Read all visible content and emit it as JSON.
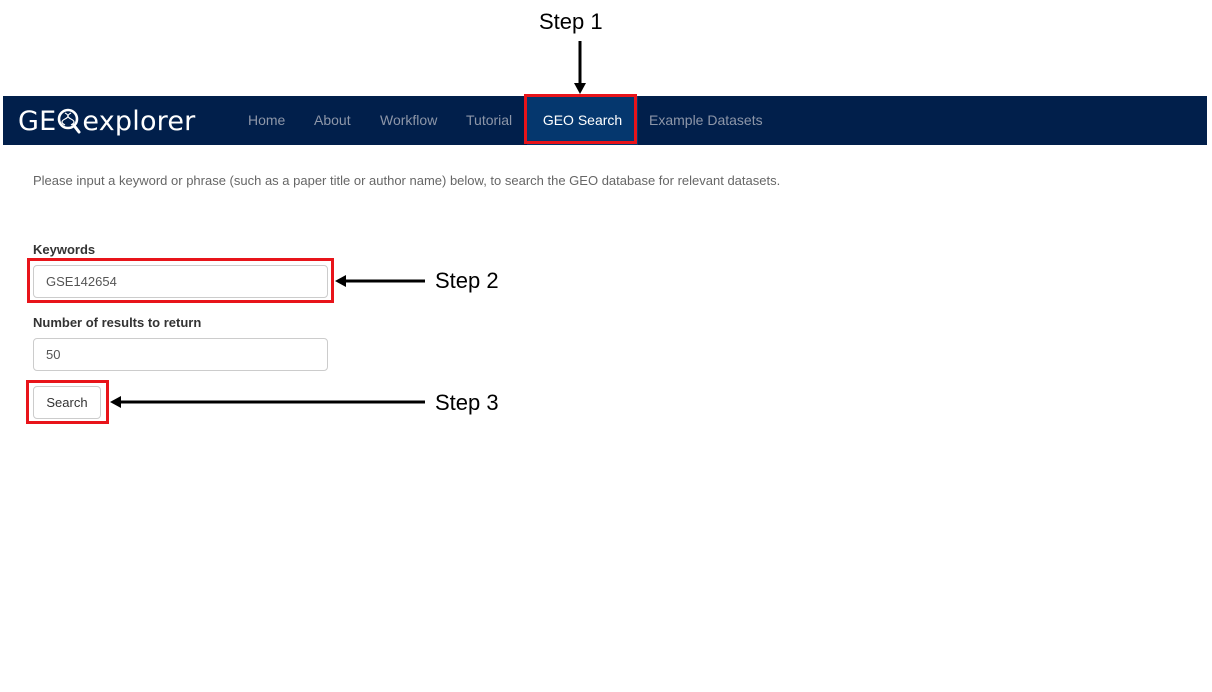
{
  "app": {
    "logo_text_left": "GE",
    "logo_text_right": "explorer"
  },
  "nav": {
    "items": [
      {
        "label": "Home"
      },
      {
        "label": "About"
      },
      {
        "label": "Workflow"
      },
      {
        "label": "Tutorial"
      },
      {
        "label": "GEO Search",
        "active": true
      },
      {
        "label": "Example Datasets"
      }
    ]
  },
  "main": {
    "intro": "Please input a keyword or phrase (such as a paper title or author name) below, to search the GEO database for relevant datasets.",
    "keywords_label": "Keywords",
    "keywords_value": "GSE142654",
    "num_results_label": "Number of results to return",
    "num_results_value": "50",
    "search_button": "Search"
  },
  "annotations": {
    "step1": "Step 1",
    "step2": "Step 2",
    "step3": "Step 3"
  },
  "colors": {
    "navbar_bg": "#011f4b",
    "nav_active_bg": "#05376e",
    "nav_text": "#8d96a8",
    "highlight": "#e8141a"
  }
}
